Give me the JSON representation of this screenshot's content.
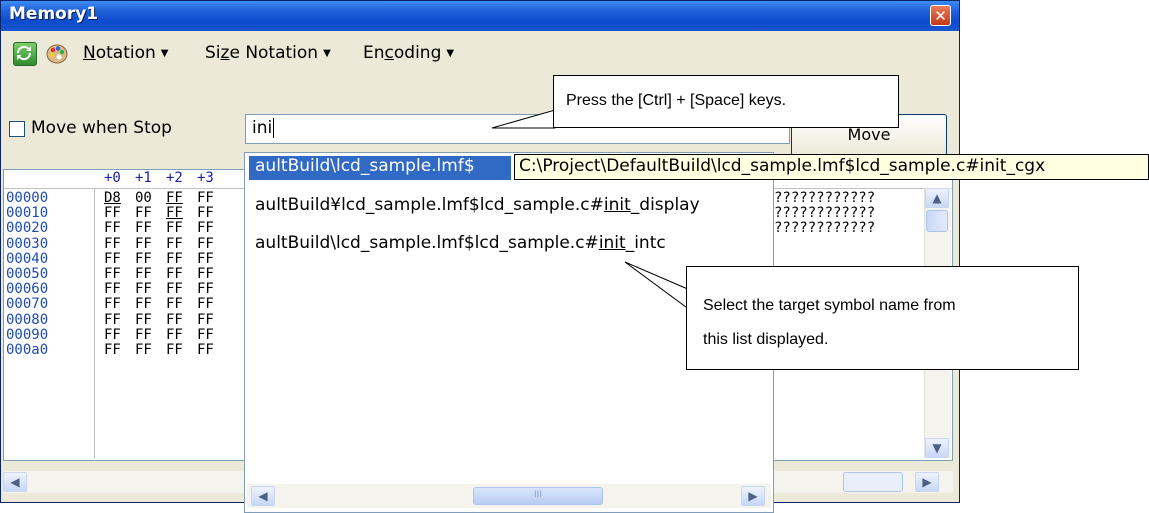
{
  "window": {
    "title": "Memory1"
  },
  "toolbar": {
    "icons": [
      "refresh-icon",
      "palette-icon"
    ],
    "menus": [
      {
        "label": "Notation",
        "mnemonic": "N"
      },
      {
        "label": "Size Notation",
        "mnemonic": "z"
      },
      {
        "label": "Encoding",
        "mnemonic": "c"
      }
    ]
  },
  "move_row": {
    "checkbox_label": "Move when Stop",
    "input_value": "ini",
    "move_button": "Move"
  },
  "grid": {
    "headers": [
      "+0",
      "+1",
      "+2",
      "+3"
    ],
    "rows": [
      {
        "addr": "00000",
        "cells": [
          "D8",
          "00",
          "FF",
          "FF"
        ],
        "ascii": "????????????"
      },
      {
        "addr": "00010",
        "cells": [
          "FF",
          "FF",
          "FF",
          "FF"
        ],
        "ascii": "????????????"
      },
      {
        "addr": "00020",
        "cells": [
          "FF",
          "FF",
          "FF",
          "FF"
        ],
        "ascii": "????????????"
      },
      {
        "addr": "00030",
        "cells": [
          "FF",
          "FF",
          "FF",
          "FF"
        ],
        "ascii": ""
      },
      {
        "addr": "00040",
        "cells": [
          "FF",
          "FF",
          "FF",
          "FF"
        ],
        "ascii": ""
      },
      {
        "addr": "00050",
        "cells": [
          "FF",
          "FF",
          "FF",
          "FF"
        ],
        "ascii": ""
      },
      {
        "addr": "00060",
        "cells": [
          "FF",
          "FF",
          "FF",
          "FF"
        ],
        "ascii": ""
      },
      {
        "addr": "00070",
        "cells": [
          "FF",
          "FF",
          "FF",
          "FF"
        ],
        "ascii": "????????????"
      },
      {
        "addr": "00080",
        "cells": [
          "FF",
          "FF",
          "FF",
          "FF"
        ],
        "ascii": "????????????"
      },
      {
        "addr": "00090",
        "cells": [
          "FF",
          "FF",
          "FF",
          "FF"
        ],
        "ascii": "????????????"
      },
      {
        "addr": "000a0",
        "cells": [
          "FF",
          "FF",
          "FF",
          "FF"
        ],
        "ascii": "????????????"
      }
    ]
  },
  "dropdown": {
    "items": [
      {
        "prefix": "aultBuild\\lcd_sample.lmf$",
        "match": "",
        "suffix": "",
        "selected": true
      },
      {
        "prefix": "aultBuild¥lcd_sample.lmf$lcd_sample.c#",
        "match": "init",
        "suffix": "_display",
        "selected": false
      },
      {
        "prefix": "aultBuild\\lcd_sample.lmf$lcd_sample.c#",
        "match": "init",
        "suffix": "_intc",
        "selected": false
      }
    ],
    "scroll_thumb": "III"
  },
  "tooltip": {
    "text": "C:\\Project\\DefaultBuild\\lcd_sample.lmf$lcd_sample.c#init_cgx"
  },
  "callouts": {
    "keys": "Press the [Ctrl] + [Space] keys.",
    "select_line1": "Select the target symbol name from",
    "select_line2": "this list displayed."
  }
}
